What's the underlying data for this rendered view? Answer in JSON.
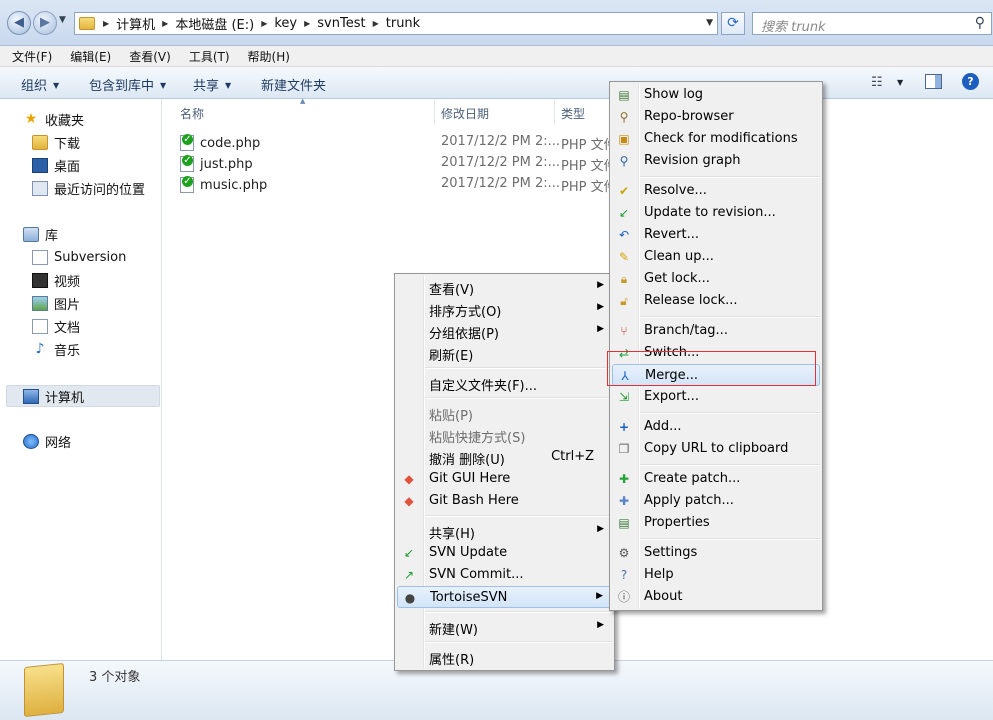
{
  "address": {
    "crumbs": [
      "计算机",
      "本地磁盘 (E:)",
      "key",
      "svnTest",
      "trunk"
    ],
    "search_placeholder": "搜索 trunk"
  },
  "menubar": [
    "文件(F)",
    "编辑(E)",
    "查看(V)",
    "工具(T)",
    "帮助(H)"
  ],
  "cmdbar": {
    "organize": "组织",
    "include_library": "包含到库中",
    "share": "共享",
    "new_folder": "新建文件夹"
  },
  "navpane": {
    "favorites": "收藏夹",
    "downloads": "下载",
    "desktop": "桌面",
    "recent": "最近访问的位置",
    "libraries": "库",
    "subversion": "Subversion",
    "videos": "视频",
    "pictures": "图片",
    "documents": "文档",
    "music": "音乐",
    "computer": "计算机",
    "network": "网络"
  },
  "columns": {
    "name": "名称",
    "modified": "修改日期",
    "type": "类型"
  },
  "files": [
    {
      "name": "code.php",
      "date": "2017/12/2 PM 2:...",
      "type": "PHP 文件"
    },
    {
      "name": "just.php",
      "date": "2017/12/2 PM 2:...",
      "type": "PHP 文件"
    },
    {
      "name": "music.php",
      "date": "2017/12/2 PM 2:...",
      "type": "PHP 文件"
    }
  ],
  "status": {
    "count": "3 个对象"
  },
  "context_menu": {
    "view": "查看(V)",
    "sort": "排序方式(O)",
    "group": "分组依据(P)",
    "refresh": "刷新(E)",
    "customize": "自定义文件夹(F)...",
    "paste": "粘贴(P)",
    "paste_shortcut": "粘贴快捷方式(S)",
    "undo": "撤消 删除(U)",
    "undo_shortcut": "Ctrl+Z",
    "git_gui": "Git GUI Here",
    "git_bash": "Git Bash Here",
    "share": "共享(H)",
    "svn_update": "SVN Update",
    "svn_commit": "SVN Commit...",
    "tortoise": "TortoiseSVN",
    "new": "新建(W)",
    "properties": "属性(R)"
  },
  "svn_menu": {
    "show_log": "Show log",
    "repo_browser": "Repo-browser",
    "check_mods": "Check for modifications",
    "revision_graph": "Revision graph",
    "resolve": "Resolve...",
    "update_rev": "Update to revision...",
    "revert": "Revert...",
    "cleanup": "Clean up...",
    "get_lock": "Get lock...",
    "release_lock": "Release lock...",
    "branch_tag": "Branch/tag...",
    "switch": "Switch...",
    "merge": "Merge...",
    "export": "Export...",
    "add": "Add...",
    "copy_url": "Copy URL to clipboard",
    "create_patch": "Create patch...",
    "apply_patch": "Apply patch...",
    "properties": "Properties",
    "settings": "Settings",
    "help": "Help",
    "about": "About"
  }
}
